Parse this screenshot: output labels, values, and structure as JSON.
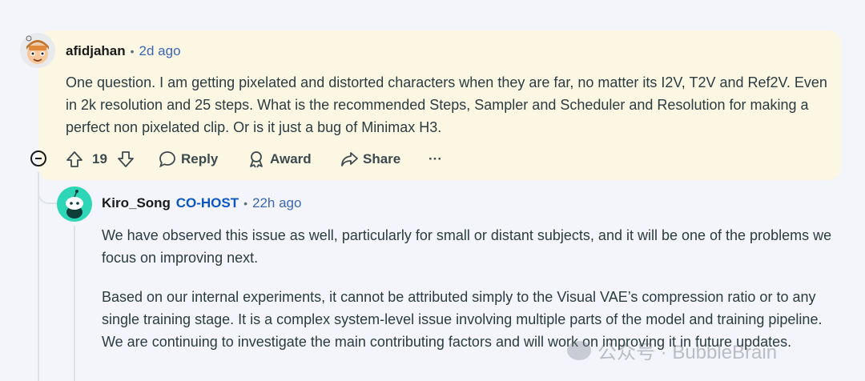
{
  "comment1": {
    "author": "afidjahan",
    "time": "2d ago",
    "text": "One question. I am getting pixelated and distorted characters when they are far, no matter its I2V, T2V and Ref2V. Even in 2k resolution and 25 steps. What is the recommended Steps, Sampler and Scheduler and Resolution for making a perfect non pixelated clip. Or is it just a bug of Minimax H3.",
    "votes": "19",
    "actions": {
      "reply": "Reply",
      "award": "Award",
      "share": "Share",
      "more": "···"
    }
  },
  "comment2": {
    "author": "Kiro_Song",
    "badge": "CO-HOST",
    "time": "22h ago",
    "paragraphs": [
      "We have observed this issue as well, particularly for small or distant subjects, and it will be one of the problems we focus on improving next.",
      "Based on our internal experiments, it cannot be attributed simply to the Visual VAE’s compression ratio or to any single training stage. It is a complex system-level issue involving multiple parts of the model and training pipeline. We are continuing to investigate the main contributing factors and will work on improving it in future updates."
    ]
  },
  "watermark": "公众号 · BubbleBrain",
  "colors": {
    "highlight": "#fcf7e2",
    "cohost": "#0b57c2",
    "avatar2": "#2dd6b6"
  }
}
